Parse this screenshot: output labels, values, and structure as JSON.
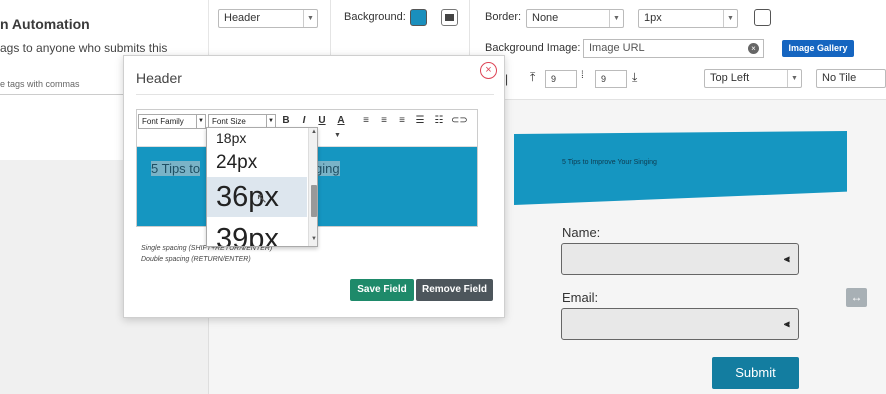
{
  "background_page": {
    "title": "n Automation",
    "description": "ags to anyone who submits this",
    "tags_hint": "e tags with commas"
  },
  "toolbar": {
    "element_select": "Header",
    "background_label": "Background:",
    "background_color": "#1a8fbd",
    "border_label": "Border:",
    "border_style": "None",
    "border_width": "1px",
    "bg_image_label": "Background Image:",
    "image_url_placeholder": "Image URL",
    "image_gallery_label": "Image Gallery",
    "padding_top": "9",
    "padding_bottom": "9",
    "position_select": "Top Left",
    "tile_select": "No Tile"
  },
  "modal": {
    "title": "Header",
    "font_family_label": "Font Family",
    "font_size_label": "Font Size",
    "bold": "B",
    "italic": "I",
    "underline": "U",
    "text_color": "A",
    "editor_text": "5 Tips to Improve Your Singing",
    "editor_text_left": "5 Tips to",
    "editor_text_right": "ging",
    "single_spacing_hint": "Single spacing (SHIFT+RETURN/ENTER)",
    "double_spacing_hint": "Double spacing (RETURN/ENTER)",
    "save_field_label": "Save Field",
    "remove_field_label": "Remove Field",
    "font_size_options": [
      "18px",
      "24px",
      "36px",
      "39px"
    ],
    "font_size_selected": "36px"
  },
  "preview": {
    "banner_text": "5 Tips to Improve Your Singing",
    "name_label": "Name:",
    "email_label": "Email:",
    "submit_label": "Submit",
    "accent_color": "#1596c1"
  }
}
